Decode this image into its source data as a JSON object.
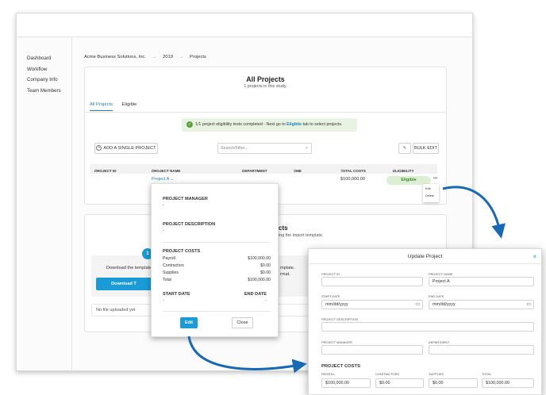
{
  "sidebar": {
    "items": [
      "Dashboard",
      "Workflow",
      "Company Info",
      "Team Members"
    ]
  },
  "breadcrumb": {
    "company": "Acme Business Solutions, Inc.",
    "sep": "→",
    "year": "2019",
    "section": "Projects"
  },
  "main": {
    "title": "All Projects",
    "subtitle": "1 projects in this study.",
    "tabs": [
      {
        "label": "All Projects"
      },
      {
        "label": "Eligible"
      }
    ],
    "banner": {
      "prefix": "1/1 project eligibility tests completed - Next go to ",
      "link": "Eligible",
      "suffix": " tab to select projects."
    },
    "add_button": "ADD A SINGLE PROJECT",
    "search_placeholder": "Search/Filter...",
    "bulk_edit": "BULK EDIT",
    "table": {
      "headers": [
        "PROJECT ID",
        "PROJECT NAME",
        "DEPARTMENT",
        "SME",
        "TOTAL COSTS",
        "ELIGIBILITY"
      ],
      "row": {
        "name": "Project A",
        "total": "$100,000.00",
        "eligibility": "Eligible"
      }
    },
    "menu": {
      "more": "•••",
      "edit": "Edit",
      "delete": "Delete"
    }
  },
  "import": {
    "title_fragment": "cts",
    "desc_fragment": "ing the import template.",
    "frag_template": "mplate.",
    "frag_format": "rmat.",
    "step": "1",
    "download_text": "Download the template",
    "download_button": "Download T",
    "no_file": "No file uploaded yet"
  },
  "popup": {
    "manager_label": "PROJECT MANAGER",
    "manager_value": "-",
    "description_label": "PROJECT DESCRIPTION",
    "description_value": "-",
    "costs_label": "PROJECT COSTS",
    "costs": [
      {
        "label": "Payroll",
        "value": "$100,000.00"
      },
      {
        "label": "Contractors",
        "value": "$0.00"
      },
      {
        "label": "Supplies",
        "value": "$0.00"
      },
      {
        "label": "Total",
        "value": "$100,000.00"
      }
    ],
    "start_label": "START DATE",
    "start_value": "-",
    "end_label": "END DATE",
    "end_value": "-",
    "edit_button": "Edit",
    "close_button": "Close"
  },
  "modal": {
    "title": "Update Project",
    "close": "×",
    "project_id_label": "PROJECT ID",
    "project_id_value": "",
    "project_name_label": "PROJECT NAME",
    "project_name_value": "Project A",
    "start_label": "START DATE",
    "end_label": "END DATE",
    "date_placeholder": "mm/dd/yyyy",
    "description_label": "PROJECT DESCRIPTION",
    "manager_label": "PROJECT MANAGER",
    "department_label": "DEPARTMENT",
    "costs_label": "PROJECT COSTS",
    "cost_labels": [
      "PAYROLL",
      "CONTRACTORS",
      "SUPPLIES",
      "TOTAL"
    ],
    "cost_values": [
      "$100,000.00",
      "$0.00",
      "$0.00",
      "$100,000.00"
    ]
  },
  "colors": {
    "accent": "#1a9ad6",
    "eligible_bg": "#dcefd3",
    "eligible_text": "#3d8c2d",
    "banner_bg": "#e8f3e2",
    "arrow": "#1769b5"
  },
  "icons": [
    "check-icon",
    "plus-circle-icon",
    "search-icon",
    "pencil-icon",
    "chevron-down-icon",
    "more-icon",
    "sort-icon",
    "calendar-icon",
    "close-icon",
    "arrow-icon"
  ]
}
